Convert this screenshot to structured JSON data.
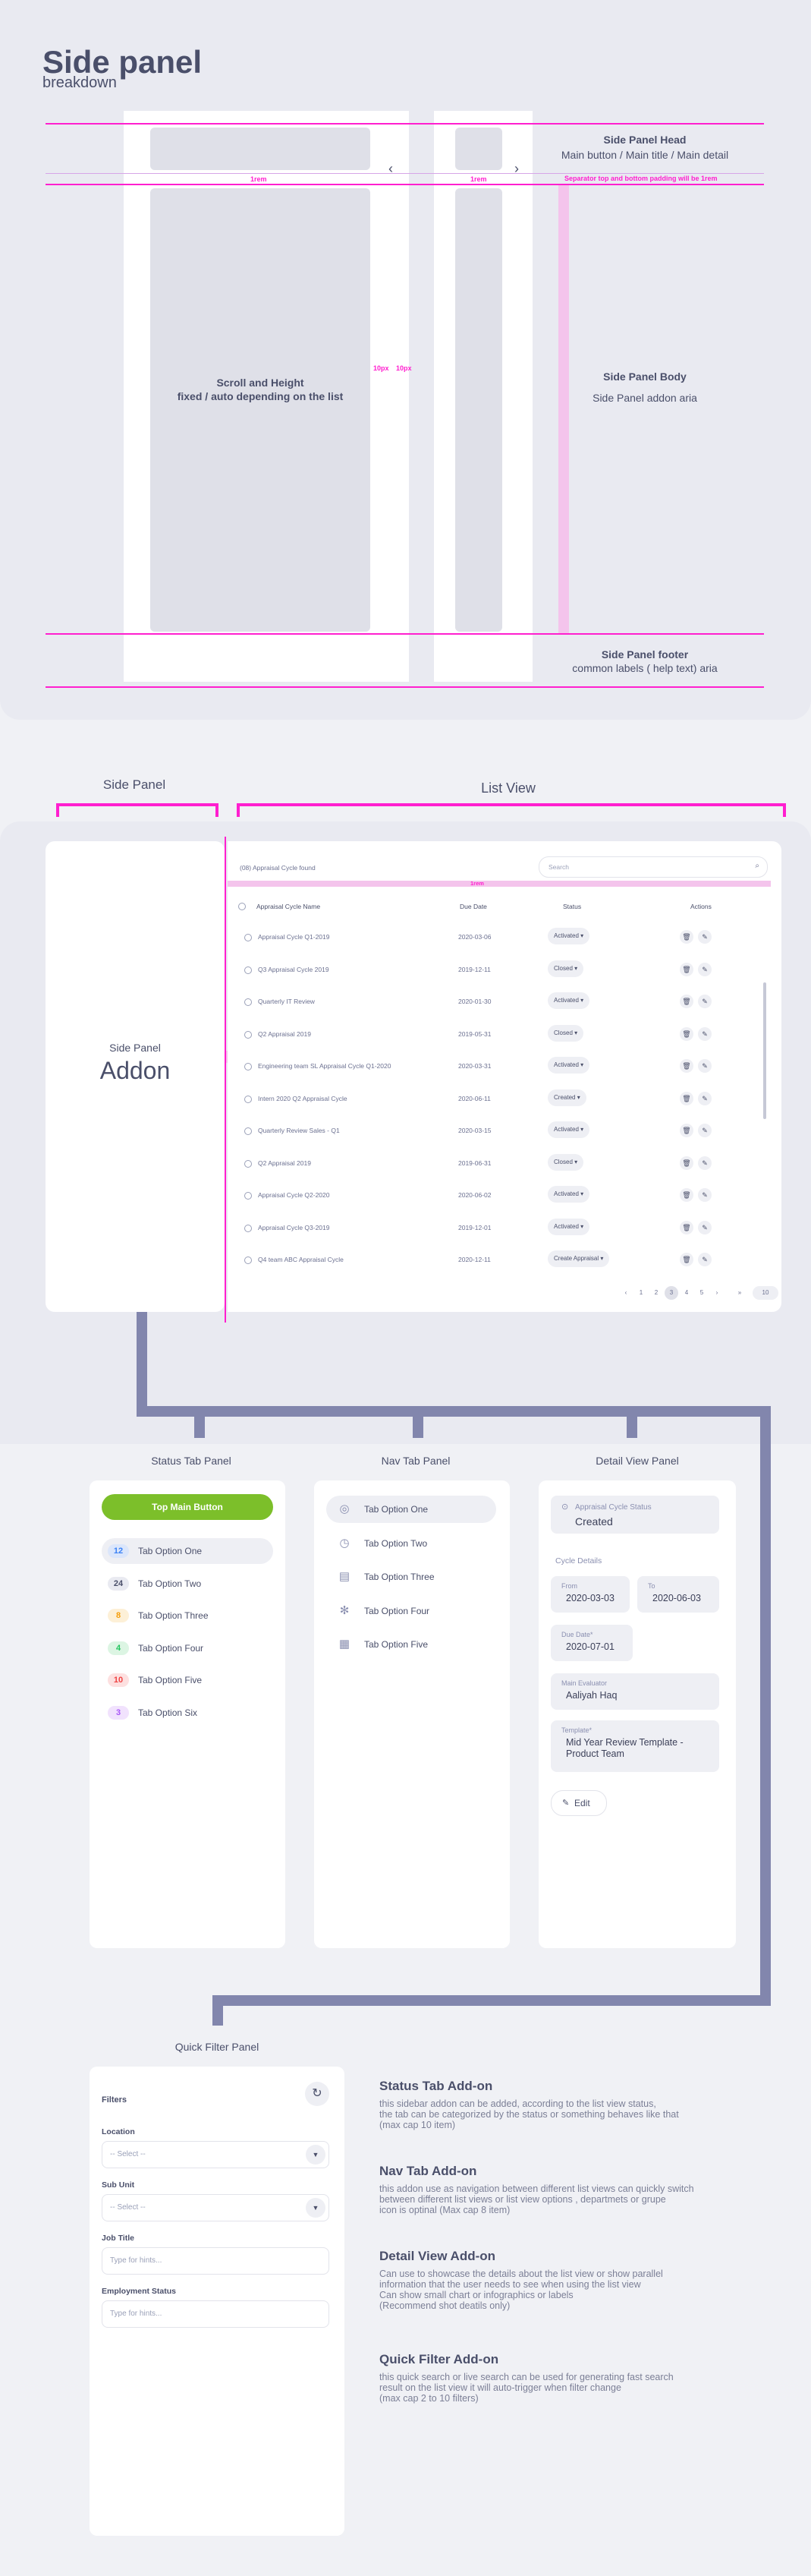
{
  "header": {
    "title": "Side panel",
    "subtitle": "breakdown"
  },
  "breakdown": {
    "head_title": "Side Panel Head",
    "head_detail": "Main button / Main title / Main detail",
    "separator_note": "Separator top and bottom padding will be 1rem",
    "rem_label": "1rem",
    "scroll_label_line1": "Scroll and Height",
    "scroll_label_line2": "fixed / auto depending on the list",
    "gap_label": "10px",
    "body_title": "Side Panel Body",
    "body_detail": "Side Panel addon aria",
    "footer_title": "Side Panel footer",
    "footer_detail": "common labels ( help text) aria",
    "arrow_left": "‹",
    "arrow_right": "›"
  },
  "section_labels": {
    "side_panel": "Side Panel",
    "list_view": "List View"
  },
  "addon_panel": {
    "small": "Side Panel",
    "big": "Addon"
  },
  "list_view": {
    "count_label": "(08) Appraisal Cycle found",
    "search_placeholder": "Search",
    "rem_label": "1rem",
    "side_rem": "1rem",
    "columns": [
      "Appraisal Cycle Name",
      "Due Date",
      "Status",
      "Actions"
    ],
    "rows": [
      {
        "name": "Appraisal Cycle Q1-2019",
        "date": "2020-03-06",
        "status": "Activated"
      },
      {
        "name": "Q3 Appraisal Cycle 2019",
        "date": "2019-12-11",
        "status": "Closed"
      },
      {
        "name": "Quarterly IT Review",
        "date": "2020-01-30",
        "status": "Activated"
      },
      {
        "name": "Q2 Appraisal 2019",
        "date": "2019-05-31",
        "status": "Closed"
      },
      {
        "name": "Engineering team SL Appraisal Cycle Q1-2020",
        "date": "2020-03-31",
        "status": "Activated"
      },
      {
        "name": "Intern 2020 Q2 Appraisal Cycle",
        "date": "2020-06-11",
        "status": "Created"
      },
      {
        "name": "Quarterly Review Sales - Q1",
        "date": "2020-03-15",
        "status": "Activated"
      },
      {
        "name": "Q2 Appraisal 2019",
        "date": "2019-06-31",
        "status": "Closed"
      },
      {
        "name": "Appraisal Cycle Q2-2020",
        "date": "2020-06-02",
        "status": "Activated"
      },
      {
        "name": "Appraisal Cycle Q3-2019",
        "date": "2019-12-01",
        "status": "Activated"
      },
      {
        "name": "Q4 team ABC Appraisal Cycle",
        "date": "2020-12-11",
        "status": "Create Appraisal"
      }
    ],
    "pagination": [
      "‹",
      "1",
      "2",
      "3",
      "4",
      "5",
      "›",
      "»"
    ],
    "active_page": "3",
    "page_size": "10"
  },
  "panel_titles": {
    "status": "Status Tab Panel",
    "nav": "Nav Tab Panel",
    "detail": "Detail View Panel",
    "quick": "Quick Filter Panel"
  },
  "status_panel": {
    "main_button": "Top Main Button",
    "items": [
      {
        "count": "12",
        "label": "Tab Option One",
        "color": "#3b82f6",
        "bg": "#dbe6fb"
      },
      {
        "count": "24",
        "label": "Tab Option Two",
        "color": "#4a4f6a",
        "bg": "#e9eaf1"
      },
      {
        "count": "8",
        "label": "Tab Option Three",
        "color": "#f59e0b",
        "bg": "#fdf0d7"
      },
      {
        "count": "4",
        "label": "Tab Option Four",
        "color": "#22c55e",
        "bg": "#dcf5e3"
      },
      {
        "count": "10",
        "label": "Tab Option Five",
        "color": "#ef4444",
        "bg": "#fde0e0"
      },
      {
        "count": "3",
        "label": "Tab Option Six",
        "color": "#a855f7",
        "bg": "#f1e2fd"
      }
    ]
  },
  "nav_panel": {
    "items": [
      {
        "label": "Tab Option One",
        "icon": "◎"
      },
      {
        "label": "Tab Option Two",
        "icon": "◷"
      },
      {
        "label": "Tab Option Three",
        "icon": "▤"
      },
      {
        "label": "Tab Option Four",
        "icon": "✻"
      },
      {
        "label": "Tab Option Five",
        "icon": "▦"
      }
    ]
  },
  "detail_panel": {
    "status_label": "Appraisal Cycle Status",
    "status_value": "Created",
    "section": "Cycle Details",
    "from_label": "From",
    "from_value": "2020-03-03",
    "to_label": "To",
    "to_value": "2020-06-03",
    "due_label": "Due Date*",
    "due_value": "2020-07-01",
    "evaluator_label": "Main Evaluator",
    "evaluator_value": "Aaliyah Haq",
    "template_label": "Template*",
    "template_value": "Mid Year Review Template - Product Team",
    "edit_button": "Edit"
  },
  "quick_filter": {
    "title": "Filters",
    "location_label": "Location",
    "location_value": "-- Select --",
    "subunit_label": "Sub Unit",
    "subunit_value": "-- Select --",
    "jobtitle_label": "Job Title",
    "jobtitle_placeholder": "Type for hints...",
    "employment_label": "Employment Status",
    "employment_placeholder": "Type for hints..."
  },
  "descriptions": [
    {
      "title": "Status Tab Add-on",
      "text": "this sidebar addon can be added, according to the list view status,\nthe tab can be categorized by the status or something behaves like that\n(max cap 10 item)"
    },
    {
      "title": "Nav Tab Add-on",
      "text": "this addon use as navigation between different list views can quickly switch\nbetween different list views or list view options , departmets or grupe\nicon is optinal (Max cap 8 item)"
    },
    {
      "title": "Detail View Add-on",
      "text": "Can use to showcase the details about the list view or show parallel\ninformation that the user needs to see when using the list view\nCan show small chart or infographics or labels\n(Recommend shot deatils only)"
    },
    {
      "title": "Quick Filter Add-on",
      "text": "this quick search or live search can be used for generating fast search\nresult on the list view it will auto-trigger when filter change\n(max cap 2 to 10 filters)"
    }
  ],
  "colors": {
    "pink": "#ff1fcf",
    "connector": "#8286ad",
    "green": "#7cbf2a"
  }
}
